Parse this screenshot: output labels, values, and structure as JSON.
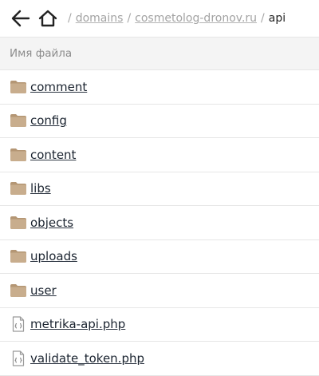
{
  "nav": {
    "back_icon": "arrow-left-icon",
    "home_icon": "home-icon"
  },
  "breadcrumb": {
    "separator": "/",
    "items": [
      "domains",
      "cosmetolog-dronov.ru"
    ],
    "current": "api"
  },
  "table": {
    "header": "Имя файла"
  },
  "files": [
    {
      "name": "comment",
      "type": "folder"
    },
    {
      "name": "config",
      "type": "folder"
    },
    {
      "name": "content",
      "type": "folder"
    },
    {
      "name": "libs",
      "type": "folder"
    },
    {
      "name": "objects",
      "type": "folder"
    },
    {
      "name": "uploads",
      "type": "folder"
    },
    {
      "name": "user",
      "type": "folder"
    },
    {
      "name": "metrika-api.php",
      "type": "file"
    },
    {
      "name": "validate_token.php",
      "type": "file"
    }
  ],
  "colors": {
    "folder": "#c8ad8d",
    "folder_dark": "#b49674",
    "file_outline": "#9a9a9a"
  }
}
